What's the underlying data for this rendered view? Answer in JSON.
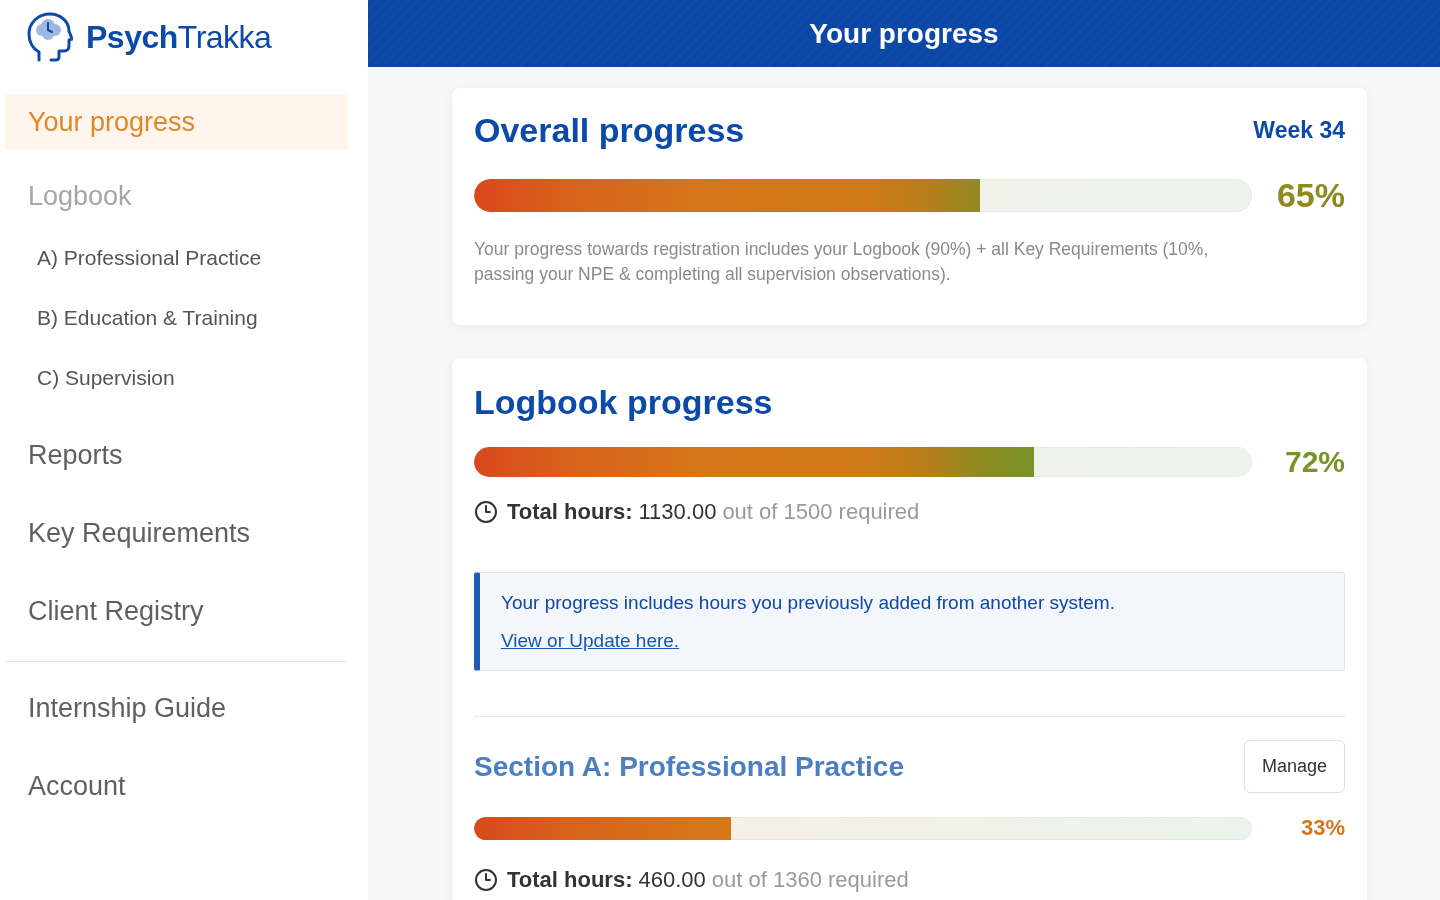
{
  "sidebar": {
    "logo": "**Psych**Trakka",
    "sections": [
      {
        "items": [
          {
            "label": "Your progress",
            "selected": true
          },
          {
            "label": "Logbook",
            "selected": false,
            "children": [
              {
                "label": "A) Professional Practice",
                "selected": false
              },
              {
                "label": "B) Education & Training",
                "selected": false
              },
              {
                "label": "C) Supervision",
                "selected": false
              }
            ]
          },
          {
            "label": "Reports",
            "selected": false
          },
          {
            "label": "Key Requirements",
            "selected": false
          },
          {
            "label": "Client Registry",
            "selected": false
          }
        ]
      },
      {
        "items": [
          {
            "label": "Internship Guide",
            "selected": false
          },
          {
            "label": "Account",
            "selected": false
          }
        ]
      }
    ]
  },
  "header": {
    "title": "Your progress"
  },
  "overall": {
    "title": "Overall progress",
    "week": "Week 34",
    "progress": {
      "level": 0.65,
      "percent": "65%"
    },
    "note": "Your progress towards registration includes your Logbook (90%) + all Key Requirements (10%, passing your NPE & completing all supervision observations)."
  },
  "logbook": {
    "title": "Logbook progress",
    "progress": {
      "level": 0.72,
      "percent": "72%"
    },
    "hours": {
      "label": "Total hours:",
      "value": "1130.00",
      "required": "out of 1500 required"
    },
    "notice": {
      "text": "Your progress includes hours you previously added from another system.",
      "link": "View or Update here."
    },
    "sections": [
      {
        "title": "Section A: Professional Practice",
        "button": "Manage",
        "progress": {
          "level": 0.33,
          "percent": "33%"
        },
        "hours": {
          "label": "Total hours:",
          "value": "460.00",
          "required": "out of 1360 required"
        }
      }
    ]
  }
}
